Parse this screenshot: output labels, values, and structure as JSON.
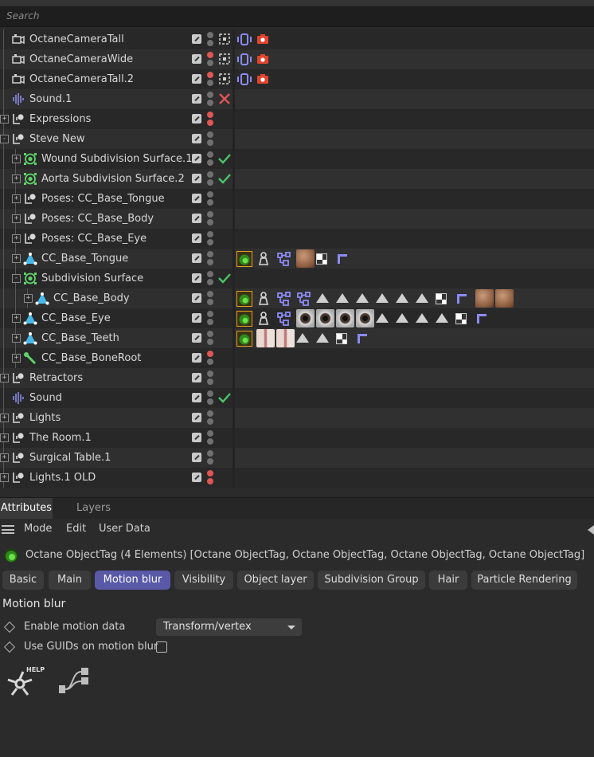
{
  "search": {
    "placeholder": "Search"
  },
  "objects": [
    {
      "name": "OctaneCameraTall",
      "depth": 0,
      "expander": "",
      "icon": "camera-icon",
      "dots": [
        "gray",
        "gray"
      ],
      "status": "grid",
      "tags": [
        "octane-camera-tag",
        "render-camera-tag"
      ]
    },
    {
      "name": "OctaneCameraWide",
      "depth": 0,
      "expander": "",
      "icon": "camera-icon",
      "dots": [
        "red",
        "gray"
      ],
      "status": "grid",
      "tags": [
        "octane-camera-tag",
        "render-camera-tag"
      ]
    },
    {
      "name": "OctaneCameraTall.2",
      "depth": 0,
      "expander": "",
      "icon": "camera-icon",
      "dots": [
        "red",
        "gray"
      ],
      "status": "grid",
      "tags": [
        "octane-camera-tag",
        "render-camera-tag"
      ]
    },
    {
      "name": "Sound.1",
      "depth": 0,
      "expander": "",
      "icon": "sound-icon",
      "dots": [
        "gray",
        "gray"
      ],
      "status": "cross",
      "tags": []
    },
    {
      "name": "Expressions",
      "depth": 0,
      "expander": "+",
      "icon": "null-icon",
      "dots": [
        "red",
        "red"
      ],
      "status": "",
      "tags": []
    },
    {
      "name": "Steve New",
      "depth": 0,
      "expander": "-",
      "icon": "null-icon",
      "dots": [
        "gray",
        "gray"
      ],
      "status": "",
      "tags": []
    },
    {
      "name": "Wound Subdivision Surface.1",
      "depth": 1,
      "expander": "+",
      "icon": "subdivision-icon",
      "dots": [
        "gray",
        "gray"
      ],
      "status": "check",
      "tags": []
    },
    {
      "name": "Aorta Subdivision Surface.2",
      "depth": 1,
      "expander": "+",
      "icon": "subdivision-icon",
      "dots": [
        "gray",
        "gray"
      ],
      "status": "check",
      "tags": []
    },
    {
      "name": "Poses: CC_Base_Tongue",
      "depth": 1,
      "expander": "+",
      "icon": "null-icon",
      "dots": [
        "gray",
        "gray"
      ],
      "status": "",
      "tags": []
    },
    {
      "name": "Poses: CC_Base_Body",
      "depth": 1,
      "expander": "+",
      "icon": "null-icon",
      "dots": [
        "gray",
        "gray"
      ],
      "status": "",
      "tags": []
    },
    {
      "name": "Poses: CC_Base_Eye",
      "depth": 1,
      "expander": "+",
      "icon": "null-icon",
      "dots": [
        "gray",
        "gray"
      ],
      "status": "",
      "tags": []
    },
    {
      "name": "CC_Base_Tongue",
      "depth": 1,
      "expander": "+",
      "icon": "polygon-icon",
      "dots": [
        "gray",
        "gray"
      ],
      "status": "",
      "tags": [
        "octane-object-tag",
        "weight-tag",
        "pose-morph-tag",
        "skin-texture",
        "uvw-checker-tag",
        "selection-tag"
      ]
    },
    {
      "name": "Subdivision Surface",
      "depth": 1,
      "expander": "-",
      "icon": "subdivision-icon",
      "dots": [
        "gray",
        "gray"
      ],
      "status": "check",
      "tags": []
    },
    {
      "name": "CC_Base_Body",
      "depth": 2,
      "expander": "+",
      "icon": "polygon-icon",
      "dots": [
        "gray",
        "gray"
      ],
      "status": "",
      "tags": [
        "octane-object-tag",
        "weight-tag",
        "pose-morph-tag",
        "pose-morph-tag",
        "tri",
        "tri",
        "tri",
        "tri",
        "tri",
        "tri",
        "uvw-checker-tag",
        "selection-tag",
        "skin-texture",
        "skin-texture"
      ]
    },
    {
      "name": "CC_Base_Eye",
      "depth": 1,
      "expander": "+",
      "icon": "polygon-icon",
      "dots": [
        "gray",
        "gray"
      ],
      "status": "",
      "tags": [
        "octane-object-tag",
        "weight-tag",
        "pose-morph-tag",
        "eye-texture",
        "eye-texture",
        "eye-texture",
        "eye-texture",
        "tri",
        "tri",
        "tri",
        "tri",
        "uvw-checker-tag",
        "selection-tag"
      ]
    },
    {
      "name": "CC_Base_Teeth",
      "depth": 1,
      "expander": "+",
      "icon": "polygon-icon",
      "dots": [
        "gray",
        "gray"
      ],
      "status": "",
      "tags": [
        "octane-object-tag",
        "teeth-texture",
        "teeth-texture",
        "tri",
        "tri",
        "uvw-checker-tag",
        "selection-tag"
      ]
    },
    {
      "name": "CC_Base_BoneRoot",
      "depth": 1,
      "expander": "+",
      "icon": "joint-icon",
      "dots": [
        "red",
        "gray"
      ],
      "status": "",
      "tags": []
    },
    {
      "name": "Retractors",
      "depth": 0,
      "expander": "+",
      "icon": "null-icon",
      "dots": [
        "gray",
        "gray"
      ],
      "status": "",
      "tags": []
    },
    {
      "name": "Sound",
      "depth": 0,
      "expander": "",
      "icon": "sound-icon",
      "dots": [
        "gray",
        "gray"
      ],
      "status": "check",
      "tags": []
    },
    {
      "name": "Lights",
      "depth": 0,
      "expander": "+",
      "icon": "null-icon",
      "dots": [
        "gray",
        "gray"
      ],
      "status": "",
      "tags": []
    },
    {
      "name": "The Room.1",
      "depth": 0,
      "expander": "+",
      "icon": "null-icon",
      "dots": [
        "gray",
        "gray"
      ],
      "status": "",
      "tags": []
    },
    {
      "name": "Surgical Table.1",
      "depth": 0,
      "expander": "+",
      "icon": "null-icon",
      "dots": [
        "gray",
        "gray"
      ],
      "status": "",
      "tags": []
    },
    {
      "name": "Lights.1 OLD",
      "depth": 0,
      "expander": "+",
      "icon": "null-icon",
      "dots": [
        "red",
        "red"
      ],
      "status": "",
      "tags": []
    }
  ],
  "attributes": {
    "tabs": [
      "Attributes",
      "Layers"
    ],
    "menu": [
      "Mode",
      "Edit",
      "User Data"
    ],
    "header": "Octane ObjectTag (4 Elements) [Octane ObjectTag, Octane ObjectTag, Octane ObjectTag, Octane ObjectTag]",
    "property_tabs": [
      "Basic",
      "Main",
      "Motion blur",
      "Visibility",
      "Object layer",
      "Subdivision Group",
      "Hair",
      "Particle Rendering"
    ],
    "active_tab": "Motion blur",
    "section_title": "Motion blur",
    "params": {
      "enable_motion_label": "Enable motion data",
      "enable_motion_value": "Transform/vertex",
      "guids_label": "Use GUIDs on motion blur",
      "guids_checked": false
    },
    "help_label": "HELP"
  },
  "colors": {
    "accent": "#5959a8",
    "selected_tag_border": "#e2a020",
    "check": "#4cc46a",
    "cross": "#e05555",
    "camera_tag": "#7b7bf0",
    "render_tag": "#e2452f"
  }
}
